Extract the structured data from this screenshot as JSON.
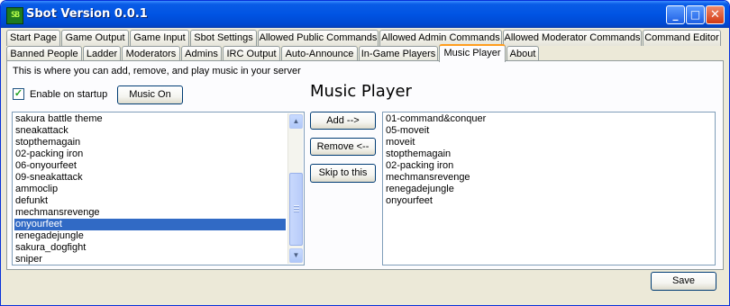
{
  "window": {
    "title": "Sbot Version 0.0.1",
    "icon_text": "SB",
    "controls": {
      "minimize": "_",
      "maximize": "□",
      "close": "✕"
    }
  },
  "tabs_row1": [
    "Start Page",
    "Game Output",
    "Game Input",
    "Sbot Settings",
    "Allowed Public Commands",
    "Allowed Admin Commands",
    "Allowed Moderator Commands",
    "Command Editor"
  ],
  "tabs_row2": [
    "Banned People",
    "Ladder",
    "Moderators",
    "Admins",
    "IRC Output",
    "Auto-Announce",
    "In-Game Players",
    "Music Player",
    "About"
  ],
  "active_tab": "Music Player",
  "music": {
    "description": "This is where you can add, remove, and play music in your server",
    "enable_on_startup_label": "Enable on startup",
    "enable_on_startup_checked": true,
    "music_toggle_label": "Music On",
    "heading": "Music Player",
    "available_tracks": [
      "sakura battle theme",
      "sneakattack",
      "stopthemagain",
      "02-packing iron",
      "06-onyourfeet",
      "09-sneakattack",
      "ammoclip",
      "defunkt",
      "mechmansrevenge",
      "onyourfeet",
      "renegadejungle",
      "sakura_dogfight",
      "sniper"
    ],
    "selected_track": "onyourfeet",
    "add_label": "Add -->",
    "remove_label": "Remove <--",
    "skip_label": "Skip to this",
    "playlist": [
      "01-command&conquer",
      "05-moveit",
      "moveit",
      "stopthemagain",
      "02-packing iron",
      "mechmansrevenge",
      "renegadejungle",
      "onyourfeet"
    ],
    "save_label": "Save"
  },
  "icons": {
    "check": "✓",
    "scroll_up": "▲",
    "scroll_down": "▼"
  },
  "colors": {
    "title_bar": "#0054e3",
    "selection": "#316ac5",
    "active_tab_accent": "#ff9d1e"
  }
}
